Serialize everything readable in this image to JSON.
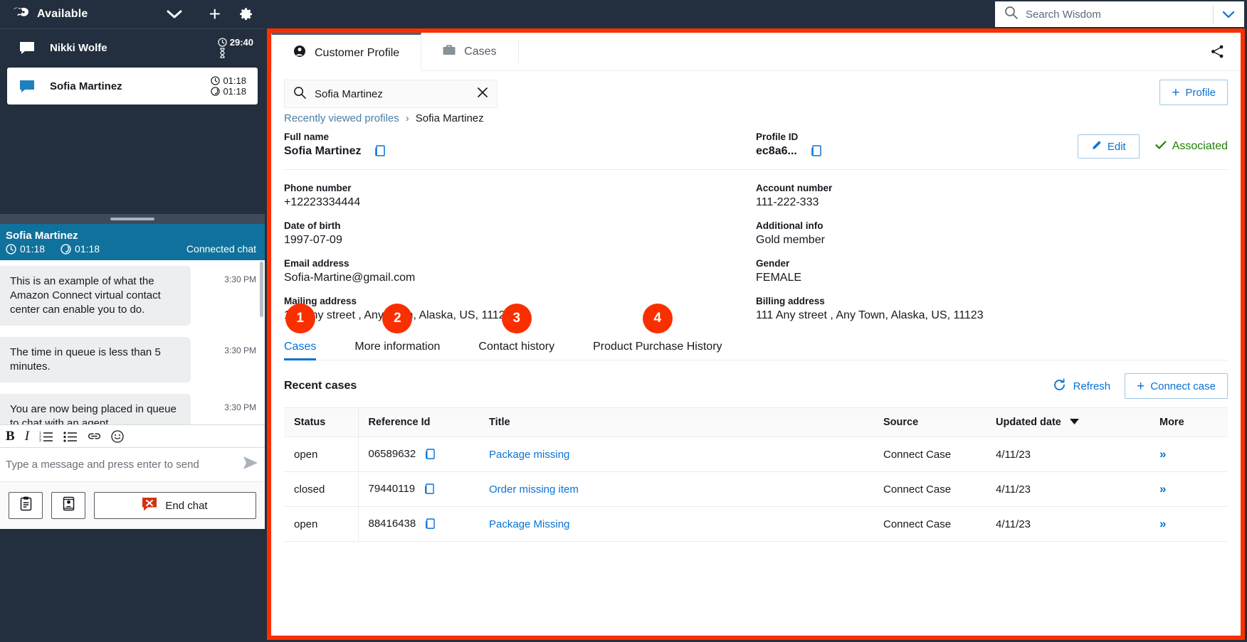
{
  "ccp": {
    "status": "Available",
    "logo_icon": "amazon-connect-logo-icon",
    "chevron_icon": "chevron-down-icon",
    "plus_icon": "plus-icon",
    "gear_icon": "gear-icon",
    "contacts": [
      {
        "name": "Nikki Wolfe",
        "timer1": "29:40",
        "timer2": "",
        "hourglass": true,
        "selected": false
      },
      {
        "name": "Sofia Martinez",
        "timer1": "01:18",
        "timer2": "01:18",
        "hourglass": false,
        "selected": true
      }
    ],
    "chat": {
      "header_name": "Sofia Martinez",
      "timer1": "01:18",
      "timer2": "01:18",
      "state": "Connected chat",
      "messages": [
        {
          "text": "This is an example of what the Amazon Connect virtual contact center can enable you to do.",
          "time": "3:30 PM"
        },
        {
          "text": "The time in queue is less than 5 minutes.",
          "time": "3:30 PM"
        },
        {
          "text": "You are now being placed in queue to chat with an agent.",
          "time": "3:30 PM"
        }
      ],
      "toolbar": [
        {
          "icon": "bold-icon",
          "label": "B"
        },
        {
          "icon": "italic-icon",
          "label": "I"
        },
        {
          "icon": "ordered-list-icon",
          "label": ""
        },
        {
          "icon": "unordered-list-icon",
          "label": ""
        },
        {
          "icon": "link-icon",
          "label": ""
        },
        {
          "icon": "emoji-icon",
          "label": ""
        }
      ],
      "compose_placeholder": "Type a message and press enter to send",
      "send_icon": "send-icon"
    },
    "footer": {
      "quick_responses_icon": "clipboard-icon",
      "contact_card_icon": "contact-card-icon",
      "end_chat_label": "End chat",
      "end_chat_icon": "end-chat-icon"
    }
  },
  "topbar": {
    "search_icon": "search-icon",
    "search_placeholder": "Search Wisdom",
    "chevron_icon": "chevron-down-icon"
  },
  "panel": {
    "tabs": [
      {
        "label": "Customer Profile",
        "icon": "user-icon",
        "active": true
      },
      {
        "label": "Cases",
        "icon": "briefcase-icon",
        "active": false
      }
    ],
    "share_icon": "share-icon",
    "search": {
      "icon": "search-icon",
      "value": "Sofia Martinez",
      "clear_icon": "close-icon"
    },
    "add_profile_label": "Profile",
    "add_profile_icon": "plus-icon",
    "breadcrumb": {
      "parent": "Recently viewed profiles",
      "separator": "›",
      "current": "Sofia Martinez"
    },
    "actions": {
      "edit_label": "Edit",
      "edit_icon": "pencil-icon",
      "associated_label": "Associated",
      "associated_icon": "check-icon"
    },
    "fields": {
      "full_name": {
        "label": "Full name",
        "value": "Sofia Martinez",
        "copy_icon": "copy-icon"
      },
      "profile_id": {
        "label": "Profile ID",
        "value": "ec8a6...",
        "copy_icon": "copy-icon"
      },
      "phone_number": {
        "label": "Phone number",
        "value": "+12223334444"
      },
      "account_number": {
        "label": "Account number",
        "value": "111-222-333"
      },
      "date_of_birth": {
        "label": "Date of birth",
        "value": "1997-07-09"
      },
      "additional_info": {
        "label": "Additional info",
        "value": "Gold member"
      },
      "email_address": {
        "label": "Email address",
        "value": "Sofia-Martine@gmail.com"
      },
      "gender": {
        "label": "Gender",
        "value": "FEMALE"
      },
      "mailing_address": {
        "label": "Mailing address",
        "value": "111 Any street , Any Town, Alaska, US, 11123"
      },
      "billing_address": {
        "label": "Billing address",
        "value": "111 Any street , Any Town, Alaska, US, 11123"
      }
    },
    "subtabs": [
      {
        "badge": "1",
        "label": "Cases",
        "active": true
      },
      {
        "badge": "2",
        "label": "More information",
        "active": false
      },
      {
        "badge": "3",
        "label": "Contact history",
        "active": false
      },
      {
        "badge": "4",
        "label": "Product Purchase History",
        "active": false
      }
    ],
    "cases": {
      "title": "Recent cases",
      "refresh_label": "Refresh",
      "refresh_icon": "refresh-icon",
      "connect_label": "Connect case",
      "connect_icon": "plus-icon",
      "columns": [
        "Status",
        "Reference Id",
        "Title",
        "Source",
        "Updated date",
        "More"
      ],
      "sorted_column": "Updated date",
      "sort_icon": "caret-down-icon",
      "rows": [
        {
          "status": "open",
          "reference_id": "06589632",
          "title": "Package missing",
          "source": "Connect Case",
          "updated_date": "4/11/23",
          "more_icon": "chevron-double-right-icon"
        },
        {
          "status": "closed",
          "reference_id": "79440119",
          "title": "Order missing item",
          "source": "Connect Case",
          "updated_date": "4/11/23",
          "more_icon": "chevron-double-right-icon"
        },
        {
          "status": "open",
          "reference_id": "88416438",
          "title": "Package Missing",
          "source": "Connect Case",
          "updated_date": "4/11/23",
          "more_icon": "chevron-double-right-icon"
        }
      ]
    }
  },
  "colors": {
    "accent_red": "#fa2f00",
    "link_blue": "#0972d3",
    "chat_header_blue": "#10719c",
    "dark_navy": "#232f3e",
    "success_green": "#1d8102"
  }
}
